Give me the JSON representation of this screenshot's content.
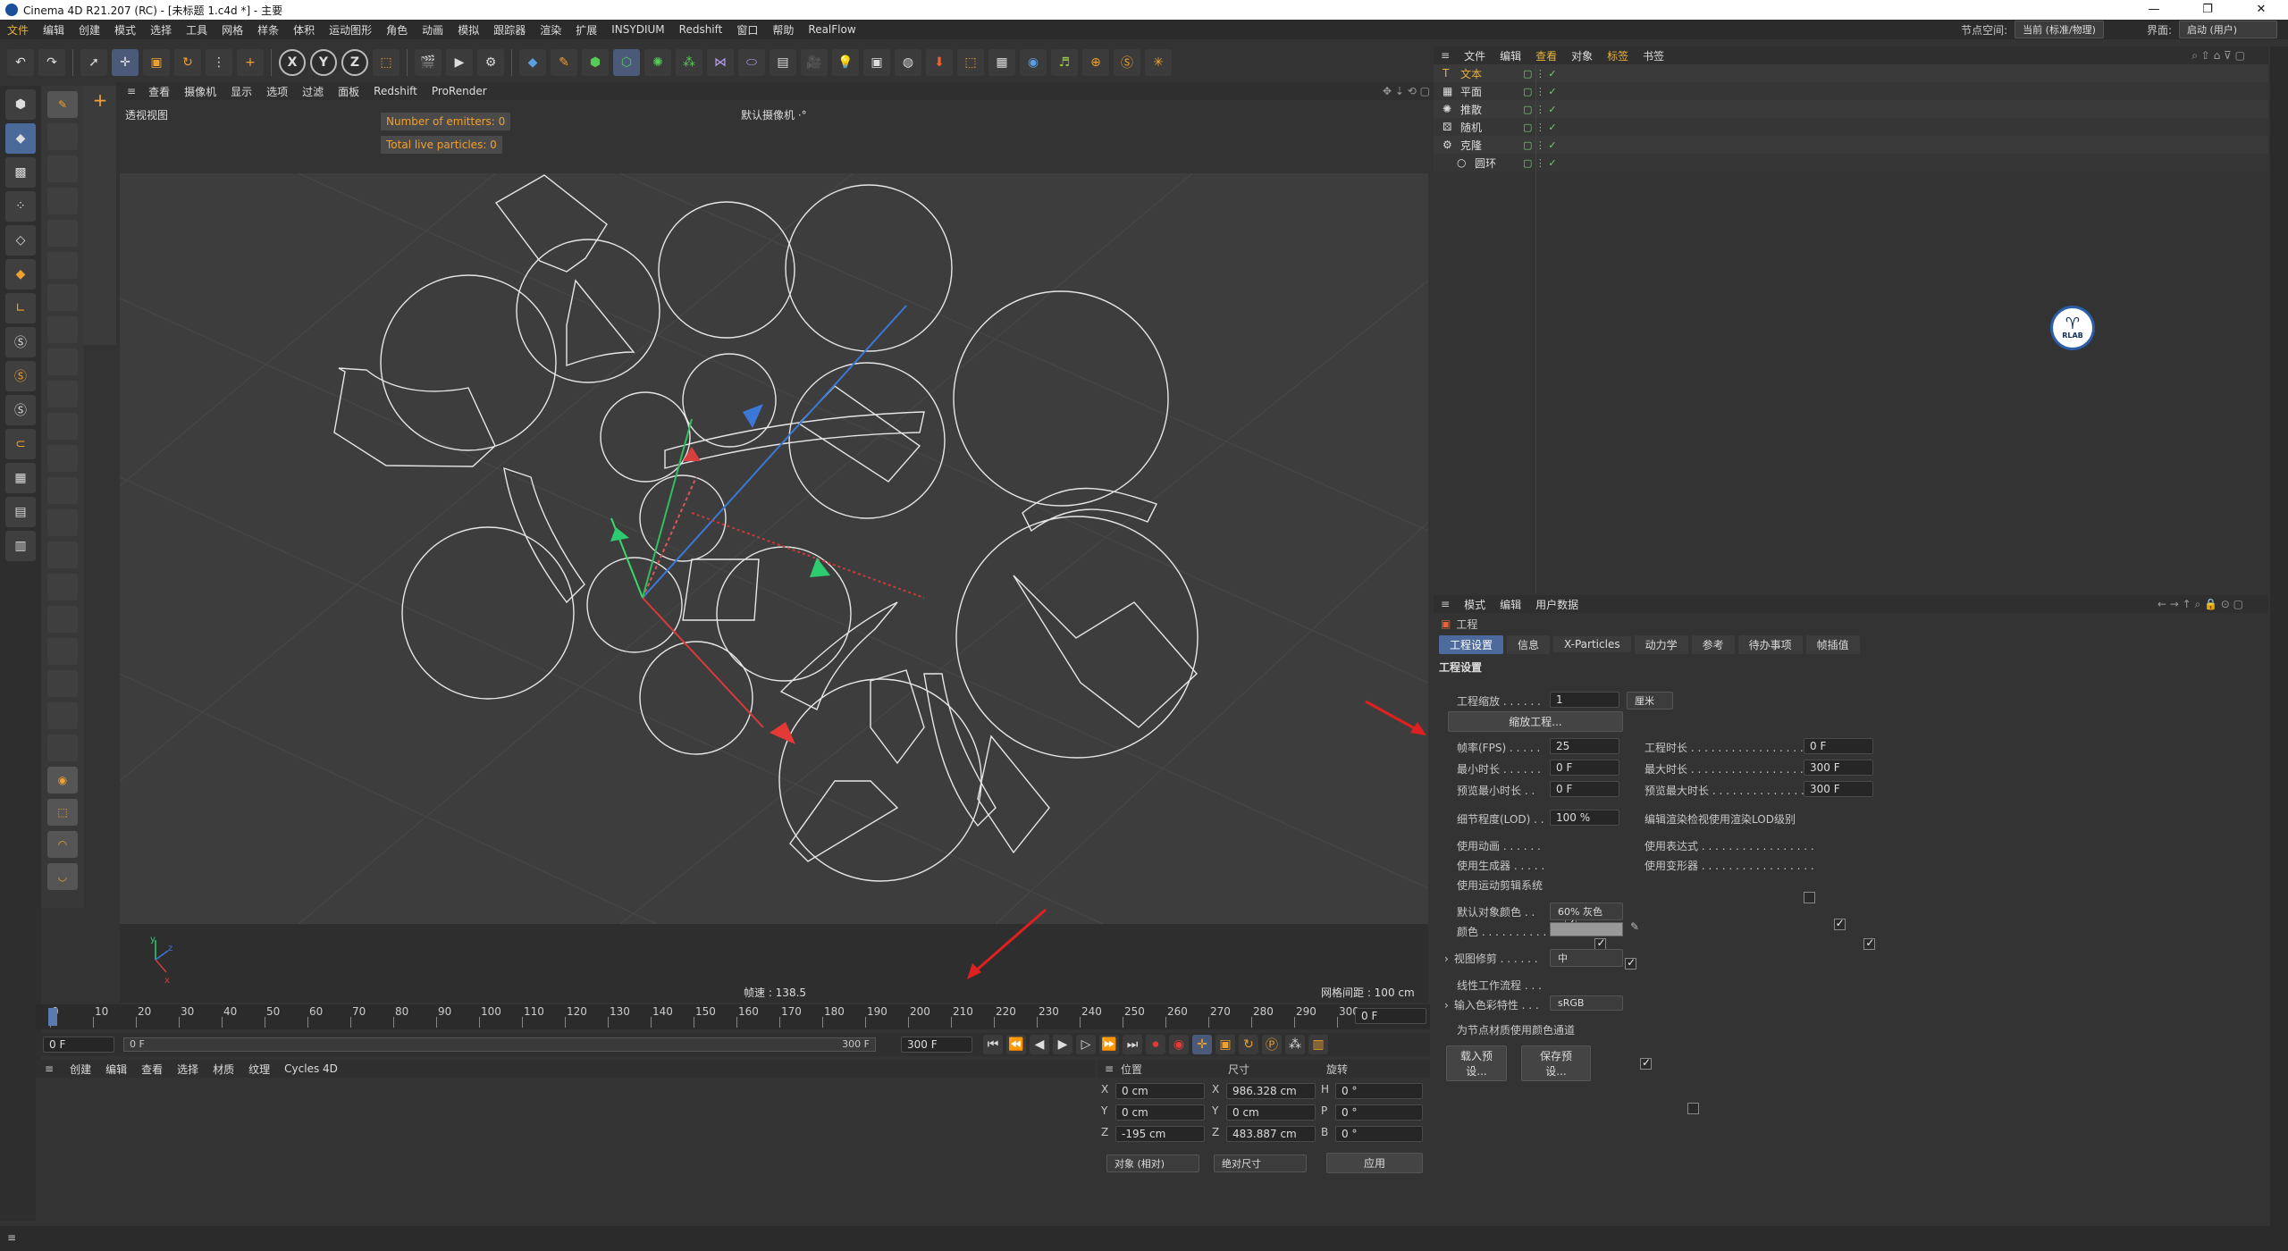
{
  "window": {
    "title": "Cinema 4D R21.207 (RC) - [未标题 1.c4d *] - 主要",
    "min": "—",
    "max": "❐",
    "close": "✕"
  },
  "menubar": {
    "items": [
      "文件",
      "编辑",
      "创建",
      "模式",
      "选择",
      "工具",
      "网格",
      "样条",
      "体积",
      "运动图形",
      "角色",
      "动画",
      "模拟",
      "跟踪器",
      "渲染",
      "扩展",
      "INSYDIUM",
      "Redshift",
      "窗口",
      "帮助",
      "RealFlow"
    ],
    "node_space_label": "节点空间:",
    "node_space_value": "当前 (标准/物理)",
    "layout_label": "界面:",
    "layout_value": "启动 (用户)"
  },
  "toolbar": {
    "axis_x": "X",
    "axis_y": "Y",
    "axis_z": "Z"
  },
  "viewport": {
    "menu": [
      "查看",
      "摄像机",
      "显示",
      "选项",
      "过滤",
      "面板",
      "Redshift",
      "ProRender"
    ],
    "name": "透视视图",
    "camera": "默认摄像机 ·°",
    "hud_emitters": "Number of emitters: 0",
    "hud_particles": "Total live particles: 0",
    "fps": "帧速 : 138.5",
    "grid": "网格间距 : 100 cm"
  },
  "timeline": {
    "ticks": [
      "0",
      "10",
      "20",
      "30",
      "40",
      "50",
      "60",
      "70",
      "80",
      "90",
      "100",
      "110",
      "120",
      "130",
      "140",
      "150",
      "160",
      "170",
      "180",
      "190",
      "200",
      "210",
      "220",
      "230",
      "240",
      "250",
      "260",
      "270",
      "280",
      "290",
      "300"
    ],
    "current_frame": "0 F",
    "start_field": "0 F",
    "preview_start": "0 F",
    "preview_end": "300 F",
    "end_field": "300 F"
  },
  "material_manager": {
    "menu": [
      "创建",
      "编辑",
      "查看",
      "选择",
      "材质",
      "纹理",
      "Cycles 4D"
    ]
  },
  "coords": {
    "headers": [
      "位置",
      "尺寸",
      "旋转"
    ],
    "rows": [
      {
        "a": "X",
        "pos": "0 cm",
        "b": "X",
        "size": "986.328 cm",
        "c": "H",
        "rot": "0 °"
      },
      {
        "a": "Y",
        "pos": "0 cm",
        "b": "Y",
        "size": "0 cm",
        "c": "P",
        "rot": "0 °"
      },
      {
        "a": "Z",
        "pos": "-195 cm",
        "b": "Z",
        "size": "483.887 cm",
        "c": "B",
        "rot": "0 °"
      }
    ],
    "mode": "对象 (相对)",
    "size_mode": "绝对尺寸",
    "apply": "应用"
  },
  "object_manager": {
    "menu": [
      "文件",
      "编辑",
      "查看",
      "对象",
      "标签",
      "书签"
    ],
    "objects": [
      {
        "name": "文本",
        "icon": "T",
        "color": "#e8b23a",
        "indent": 0
      },
      {
        "name": "平面",
        "icon": "▦",
        "color": "#ddd",
        "indent": 0
      },
      {
        "name": "推散",
        "icon": "✺",
        "color": "#ddd",
        "indent": 0
      },
      {
        "name": "随机",
        "icon": "⚄",
        "color": "#ddd",
        "indent": 0
      },
      {
        "name": "克隆",
        "icon": "⚙",
        "color": "#ddd",
        "indent": 0
      },
      {
        "name": "圆环",
        "icon": "○",
        "color": "#ddd",
        "indent": 1
      }
    ]
  },
  "attributes": {
    "menu": [
      "模式",
      "编辑",
      "用户数据"
    ],
    "header": "工程",
    "tabs": [
      "工程设置",
      "信息",
      "X-Particles",
      "动力学",
      "参考",
      "待办事项",
      "帧插值"
    ],
    "section": "工程设置",
    "scale_label": "工程缩放 . . . . . .",
    "scale_value": "1",
    "scale_unit": "厘米",
    "scale_button": "缩放工程...",
    "fps_label": "帧率(FPS) . . . . .",
    "fps_value": "25",
    "duration_label": "工程时长 . . . . . . . . . . . . . . . . . . .",
    "duration_value": "0 F",
    "min_label": "最小时长 . . . . . .",
    "min_value": "0 F",
    "max_label": "最大时长 . . . . . . . . . . . . . . . . . . .",
    "max_value": "300 F",
    "pmin_label": "预览最小时长 . .",
    "pmin_value": "0 F",
    "pmax_label": "预览最大时长 . . . . . . . . . . . . . . . .",
    "pmax_value": "300 F",
    "lod_label": "细节程度(LOD) . .",
    "lod_value": "100 %",
    "lod_check_label": "编辑渲染检视使用渲染LOD级别",
    "use_anim": "使用动画 . . . . . .",
    "use_expr": "使用表达式 . . . . . . . . . . . . . . . . .",
    "use_gen": "使用生成器 . . . . .",
    "use_deform": "使用变形器 . . . . . . . . . . . . . . . . .",
    "use_motion": "使用运动剪辑系统",
    "def_color_label": "默认对象颜色 . .",
    "def_color_value": "60% 灰色",
    "color_label": "颜色 . . . . . . . . . .",
    "clip_label": "视图修剪 . . . . . .",
    "clip_value": "中",
    "linear_label": "线性工作流程 . . .",
    "input_color_label": "输入色彩特性 . . .",
    "input_color_value": "sRGB",
    "node_color_label": "为节点材质使用颜色通道",
    "load_preset": "载入预设...",
    "save_preset": "保存预设..."
  },
  "logo_text": "RLAB"
}
